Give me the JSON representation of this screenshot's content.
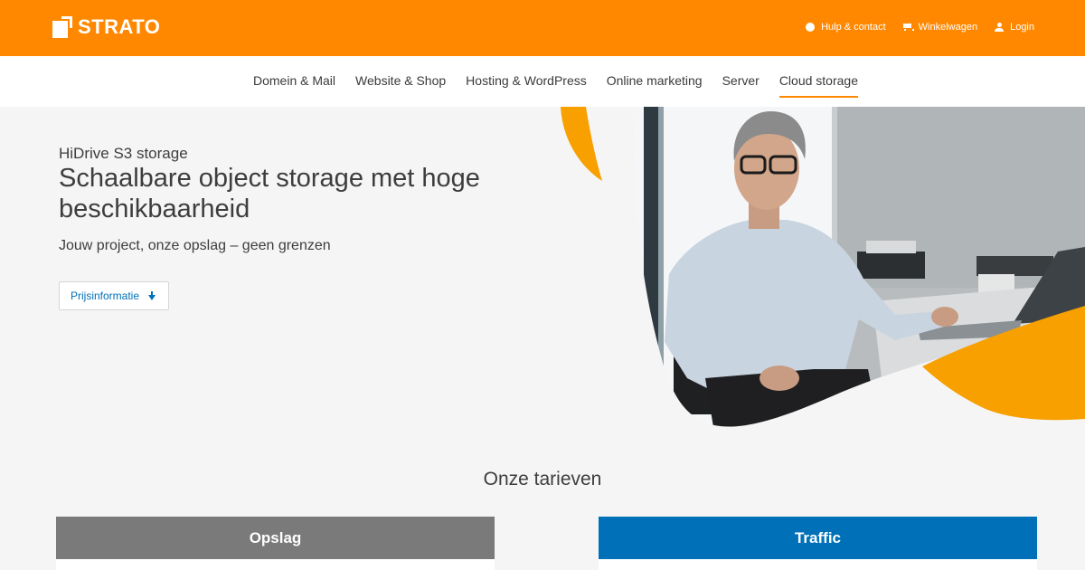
{
  "brand": {
    "name": "STRATO",
    "color": "#ff8800"
  },
  "utility_nav": [
    {
      "label": "Hulp & contact",
      "icon": "help-icon"
    },
    {
      "label": "Winkelwagen",
      "icon": "cart-icon"
    },
    {
      "label": "Login",
      "icon": "user-icon"
    }
  ],
  "main_nav": [
    {
      "label": "Domein & Mail"
    },
    {
      "label": "Website & Shop"
    },
    {
      "label": "Hosting & WordPress"
    },
    {
      "label": "Online marketing"
    },
    {
      "label": "Server"
    },
    {
      "label": "Cloud storage",
      "active": true
    }
  ],
  "hero": {
    "eyebrow": "HiDrive S3 storage",
    "headline": "Schaalbare object storage met hoge beschikbaarheid",
    "subline": "Jouw project, onze opslag – geen grenzen",
    "button_label": "Prijsinformatie",
    "image": "man-with-glasses-at-laptop-photo"
  },
  "pricing": {
    "title": "Onze tarieven",
    "cards": [
      {
        "label": "Opslag",
        "color": "#7a7a7a"
      },
      {
        "label": "Traffic",
        "color": "#0071b9"
      }
    ]
  }
}
